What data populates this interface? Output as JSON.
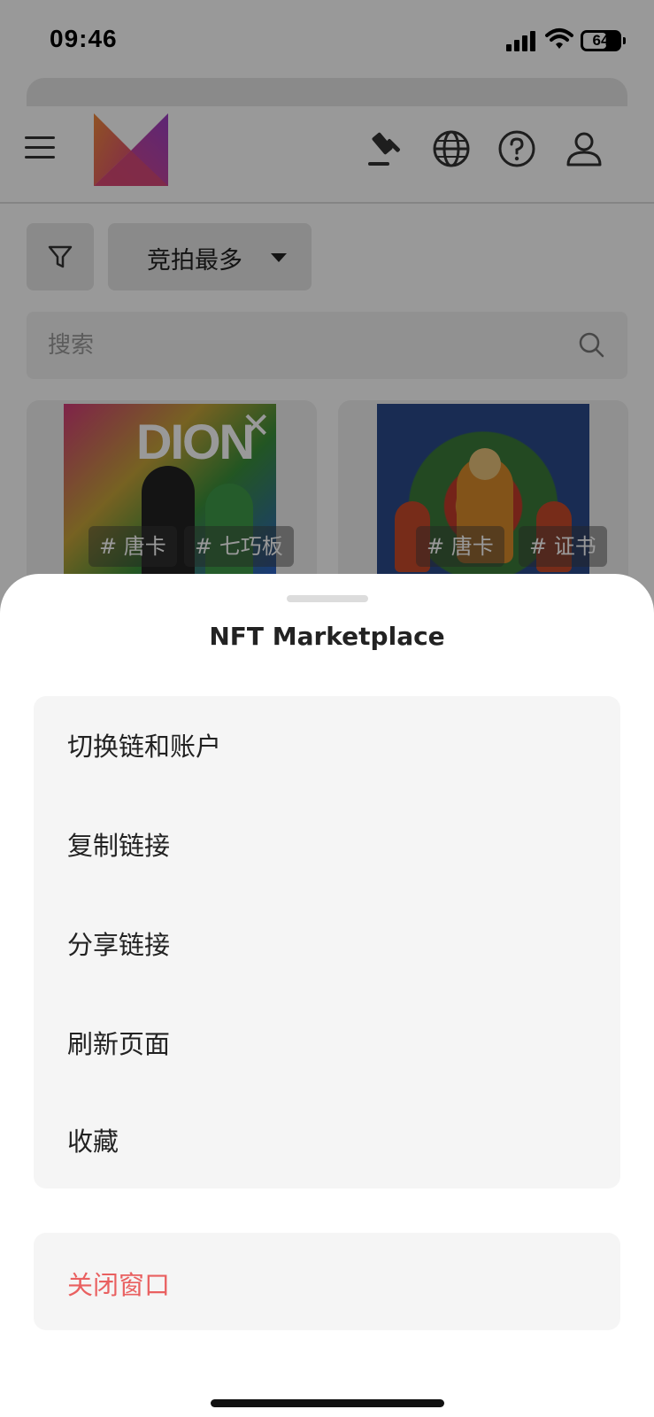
{
  "status_bar": {
    "time": "09:46",
    "battery": "64"
  },
  "header": {
    "icons": [
      "menu-icon",
      "logo",
      "gavel-icon",
      "globe-icon",
      "help-icon",
      "user-icon"
    ]
  },
  "toolbar": {
    "sort_label": "竞拍最多"
  },
  "search": {
    "placeholder": "搜索"
  },
  "cards": [
    {
      "tags": [
        "# 唐卡",
        "# 七巧板"
      ],
      "art_text": "DION"
    },
    {
      "tags": [
        "# 唐卡",
        "# 证书"
      ]
    }
  ],
  "action_sheet": {
    "title": "NFT Marketplace",
    "items": [
      {
        "label": "切换链和账户"
      },
      {
        "label": "复制链接"
      },
      {
        "label": "分享链接"
      },
      {
        "label": "刷新页面"
      },
      {
        "label": "收藏"
      }
    ],
    "close_label": "关闭窗口"
  },
  "colors": {
    "close_text": "#e96060",
    "sheet_bg": "#ffffff",
    "group_bg": "#f5f5f5"
  }
}
